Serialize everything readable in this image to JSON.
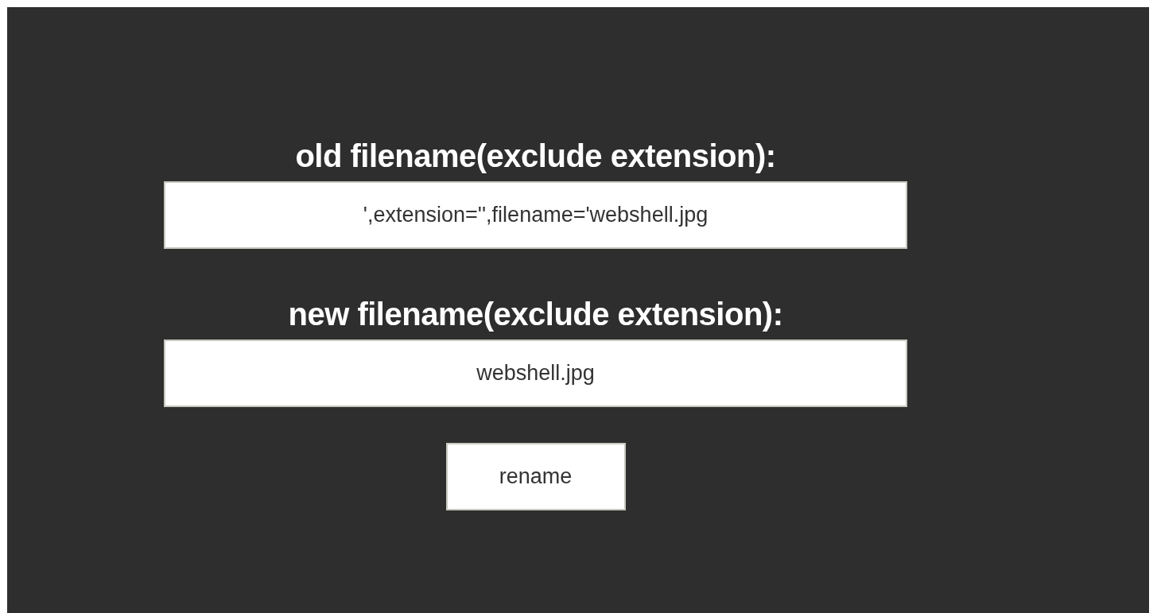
{
  "form": {
    "fields": [
      {
        "label": "old filename(exclude extension):",
        "value": "',extension='',filename='webshell.jpg"
      },
      {
        "label": "new filename(exclude extension):",
        "value": "webshell.jpg"
      }
    ],
    "button": "rename"
  }
}
